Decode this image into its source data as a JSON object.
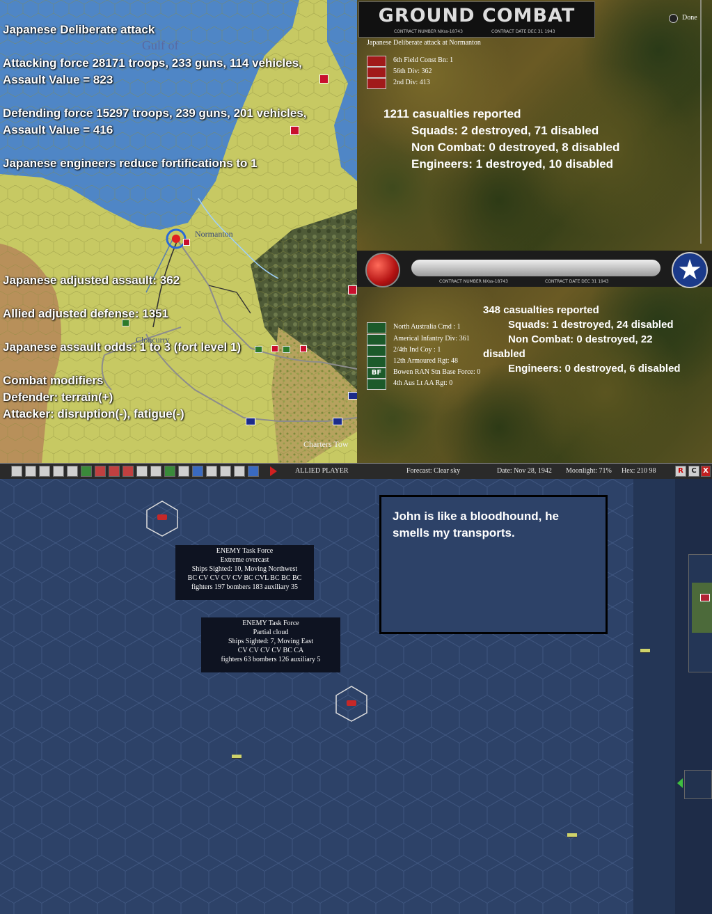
{
  "land_map": {
    "report_lines": [
      "Japanese Deliberate attack",
      "Attacking force 28171 troops, 233 guns, 114 vehicles,",
      "Assault Value = 823",
      "Defending force 15297 troops, 239 guns, 201 vehicles,",
      "Assault Value = 416",
      "Japanese engineers reduce fortifications to 1",
      "Japanese adjusted assault: 362",
      "Allied adjusted defense: 1351",
      "Japanese assault odds: 1 to 3 (fort level 1)",
      "Combat modifiers",
      "Defender: terrain(+)",
      "Attacker: disruption(-), fatigue(-)"
    ],
    "places": {
      "gulf": "Gulf of",
      "normanton": "Normanton",
      "cloncurry": "Cloncurry",
      "charters_towers": "Charters Tow"
    },
    "colors": {
      "land": "#c7c963",
      "sea": "#4f86c6",
      "desert": "#b7935a",
      "jungle": "#4d5a34",
      "road": "#8c8c8c"
    }
  },
  "combat_panel": {
    "title": "GROUND COMBAT",
    "contract_number": "CONTRACT NUMBER NXss-18743",
    "contract_date": "CONTRACT DATE DEC 31 1943",
    "done_label": "Done",
    "subtitle": "Japanese Deliberate attack at Normanton",
    "attacker_units": [
      {
        "label": "6th Field Const Bn: 1",
        "icon": "infantry-icon"
      },
      {
        "label": "56th Div: 362",
        "icon": "infantry-icon"
      },
      {
        "label": "2nd Div: 413",
        "icon": "infantry-icon"
      }
    ],
    "attacker_casualties": {
      "total": "1211 casualties reported",
      "squads": "Squads: 2 destroyed, 71 disabled",
      "noncombat": "Non Combat: 0 destroyed, 8 disabled",
      "engineers": "Engineers: 1 destroyed, 10 disabled"
    },
    "defender_units": [
      {
        "label": "North Australia Cmd : 1",
        "icon": "hq-icon"
      },
      {
        "label": "Americal Infantry Div: 361",
        "icon": "infantry-icon"
      },
      {
        "label": "2/4th Ind Coy : 1",
        "icon": "infantry-icon"
      },
      {
        "label": "12th Armoured Rgt: 48",
        "icon": "armor-icon"
      },
      {
        "label": "Bowen RAN Stn Base Force: 0",
        "icon": "base-force-icon",
        "badge": "BF"
      },
      {
        "label": "4th Aus Lt AA Rgt: 0",
        "icon": "aa-icon"
      }
    ],
    "defender_casualties": {
      "total": "348 casualties reported",
      "squads": "Squads: 1 destroyed, 24 disabled",
      "noncombat_a": "Non Combat: 0 destroyed, 22",
      "noncombat_b": "disabled",
      "engineers": "Engineers: 0 destroyed, 6 disabled"
    }
  },
  "toolbar": {
    "side": "ALLIED PLAYER",
    "forecast": "Forecast: Clear sky",
    "date": "Date: Nov 28, 1942",
    "moonlight": "Moonlight: 71%",
    "hex": "Hex: 210 98",
    "right_buttons": [
      "R",
      "C",
      "X"
    ]
  },
  "ocean_map": {
    "task_forces": [
      {
        "lines": [
          "ENEMY Task Force",
          "Extreme overcast",
          "Ships Sighted: 10, Moving Northwest",
          "BC CV CV CV CV BC CVL BC BC BC",
          "fighters 197  bombers 183  auxiliary 35"
        ]
      },
      {
        "lines": [
          "ENEMY Task Force",
          "Partial cloud",
          "Ships Sighted: 7, Moving East",
          "CV CV CV CV BC CA",
          "fighters 63  bombers 126  auxiliary 5"
        ]
      }
    ],
    "note": "John is like a bloodhound, he smells my transports."
  }
}
